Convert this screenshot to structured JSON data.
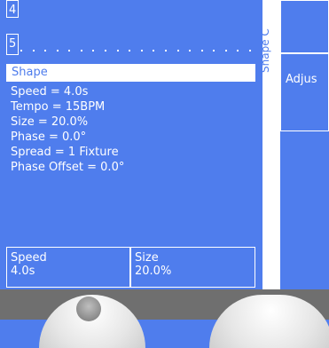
{
  "rows": {
    "row4": "4",
    "row5": "5"
  },
  "shape_panel": {
    "header": "Shape",
    "properties": [
      "Speed = 4.0s",
      "Tempo = 15BPM",
      "Size = 20.0%",
      "Phase = 0.0°",
      "Spread = 1 Fixture",
      "Phase Offset = 0.0°"
    ]
  },
  "bottom_boxes": {
    "speed": {
      "label": "Speed",
      "value": "4.0s"
    },
    "size": {
      "label": "Size",
      "value": "20.0%"
    }
  },
  "vertical_title": "Shape C",
  "right_panel": {
    "adjust_label": "Adjus"
  },
  "colors": {
    "background": "#4f7ded",
    "text": "#ffffff",
    "bottom": "#6f6f6f"
  }
}
